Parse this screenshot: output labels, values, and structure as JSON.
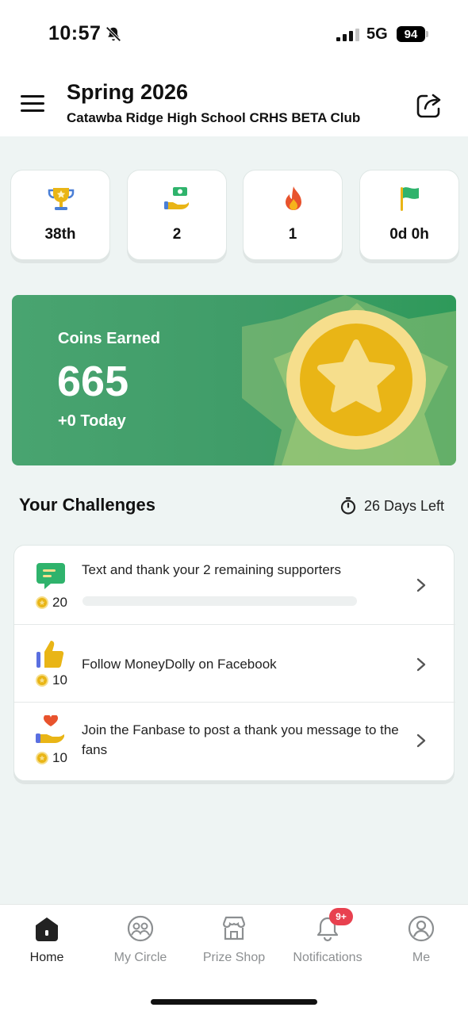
{
  "status_bar": {
    "time": "10:57",
    "network": "5G",
    "battery": "94"
  },
  "header": {
    "title": "Spring 2026",
    "subtitle": "Catawba Ridge High School CRHS BETA Club"
  },
  "stats": [
    {
      "icon": "trophy-icon",
      "value": "38th"
    },
    {
      "icon": "donation-hand-icon",
      "value": "2"
    },
    {
      "icon": "flame-icon",
      "value": "1"
    },
    {
      "icon": "flag-icon",
      "value": "0d 0h"
    }
  ],
  "coins": {
    "label": "Coins Earned",
    "value": "665",
    "today": "+0 Today"
  },
  "challenges": {
    "title": "Your Challenges",
    "days_left": "26 Days Left",
    "items": [
      {
        "icon": "chat-icon",
        "points": "20",
        "text": "Text and thank your 2 remaining supporters",
        "progress": 0
      },
      {
        "icon": "thumbs-up-icon",
        "points": "10",
        "text": "Follow MoneyDolly on Facebook"
      },
      {
        "icon": "heart-hand-icon",
        "points": "10",
        "text": "Join the Fanbase to post a thank you message to the fans"
      }
    ]
  },
  "tabbar": {
    "items": [
      {
        "label": "Home",
        "icon": "home-icon",
        "active": true
      },
      {
        "label": "My Circle",
        "icon": "circle-people-icon"
      },
      {
        "label": "Prize Shop",
        "icon": "shop-icon"
      },
      {
        "label": "Notifications",
        "icon": "bell-icon"
      },
      {
        "label": "Me",
        "icon": "profile-icon"
      }
    ],
    "notification_badge": "9+"
  },
  "colors": {
    "accent_green": "#3f9c68",
    "coin_gold": "#e9b516",
    "badge_red": "#e8414f",
    "background": "#eef4f3"
  }
}
